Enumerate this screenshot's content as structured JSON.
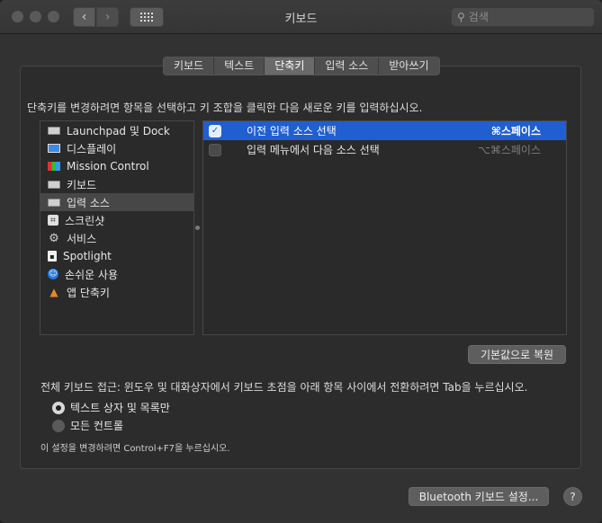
{
  "window": {
    "title": "키보드"
  },
  "toolbar": {
    "back_icon": "chevron-left-icon",
    "forward_icon": "chevron-right-icon",
    "grid_icon": "grid-icon",
    "search_placeholder": "검색"
  },
  "tabs": [
    {
      "label": "키보드",
      "active": false
    },
    {
      "label": "텍스트",
      "active": false
    },
    {
      "label": "단축키",
      "active": true
    },
    {
      "label": "입력 소스",
      "active": false
    },
    {
      "label": "받아쓰기",
      "active": false
    }
  ],
  "instruction": "단축키를 변경하려면 항목을 선택하고 키 조합을 클릭한 다음 새로운 키를 입력하십시오.",
  "categories": [
    {
      "label": "Launchpad 및 Dock",
      "icon": "launchpad-icon"
    },
    {
      "label": "디스플레이",
      "icon": "display-icon"
    },
    {
      "label": "Mission Control",
      "icon": "mission-control-icon"
    },
    {
      "label": "키보드",
      "icon": "keyboard-icon"
    },
    {
      "label": "입력 소스",
      "icon": "input-source-icon",
      "selected": true
    },
    {
      "label": "스크린샷",
      "icon": "screenshot-icon"
    },
    {
      "label": "서비스",
      "icon": "gear-icon"
    },
    {
      "label": "Spotlight",
      "icon": "spotlight-icon"
    },
    {
      "label": "손쉬운 사용",
      "icon": "accessibility-icon"
    },
    {
      "label": "앱 단축키",
      "icon": "app-shortcuts-icon"
    }
  ],
  "shortcuts": [
    {
      "label": "이전 입력 소스 선택",
      "key": "⌘스페이스",
      "checked": true,
      "selected": true
    },
    {
      "label": "입력 메뉴에서 다음 소스 선택",
      "key": "⌥⌘스페이스",
      "checked": false,
      "selected": false
    }
  ],
  "restore_button": "기본값으로 복원",
  "full_keyboard_access": "전체 키보드 접근: 윈도우 및 대화상자에서 키보드 초점을 아래 항목 사이에서 전환하려면 Tab을 누르십시오.",
  "radio_options": [
    {
      "label": "텍스트 상자 및 목록만",
      "selected": true
    },
    {
      "label": "모든 컨트롤",
      "selected": false
    }
  ],
  "hint": "이 설정을 변경하려면 Control+F7을 누르십시오.",
  "bluetooth_button": "Bluetooth 키보드 설정...",
  "help_button": "?"
}
